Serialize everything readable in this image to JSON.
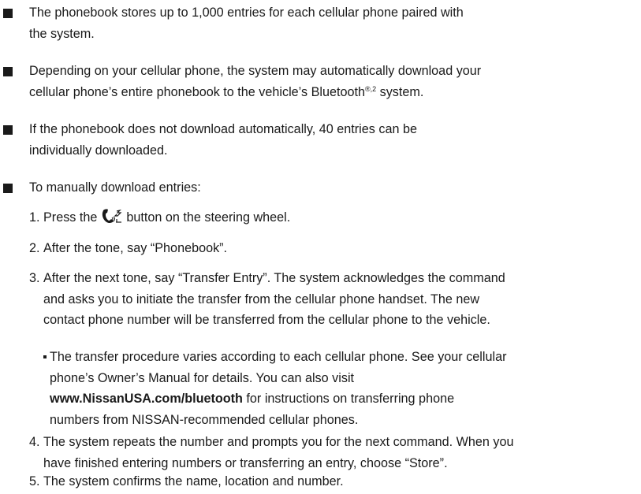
{
  "bullets": [
    {
      "line1": "The phonebook stores up to 1,000 entries for each cellular phone paired with",
      "line2": "the system."
    },
    {
      "line1": "Depending on your cellular phone, the system may automatically download your",
      "line2_prefix": "cellular phone’s entire phonebook to the vehicle’s Bluetooth",
      "line2_sup": "®,2",
      "line2_suffix": " system."
    },
    {
      "line1": "If the phonebook does not download automatically, 40 entries can be",
      "line2": "individually downloaded."
    },
    {
      "line1": "To manually download entries:"
    }
  ],
  "steps": [
    {
      "num": "1.",
      "prefix": "Press the ",
      "icon": "phone-voice-icon",
      "suffix": " button on the steering wheel."
    },
    {
      "num": "2.",
      "text": "After the tone, say “Phonebook”."
    },
    {
      "num": "3.",
      "line1": "After the next tone, say “Transfer Entry”. The system acknowledges the command",
      "line2": "and asks you to initiate the transfer from the cellular phone handset. The new",
      "line3": "contact phone number will be transferred from the cellular phone to the vehicle."
    },
    {
      "num": "4.",
      "line1": "The system repeats the number and prompts you for the next command. When you",
      "line2": "have finished entering numbers or transferring an entry, choose “Store”."
    },
    {
      "num": "5.",
      "text": "The system confirms the name, location and number."
    }
  ],
  "sub_note": {
    "line1": "The transfer procedure varies according to each cellular phone. See your cellular",
    "line2": "phone’s Owner’s Manual for details. You can also visit",
    "url": "www.NissanUSA.com/bluetooth",
    "line3_suffix": " for instructions on transferring phone",
    "line4": "numbers from NISSAN-recommended cellular phones."
  }
}
